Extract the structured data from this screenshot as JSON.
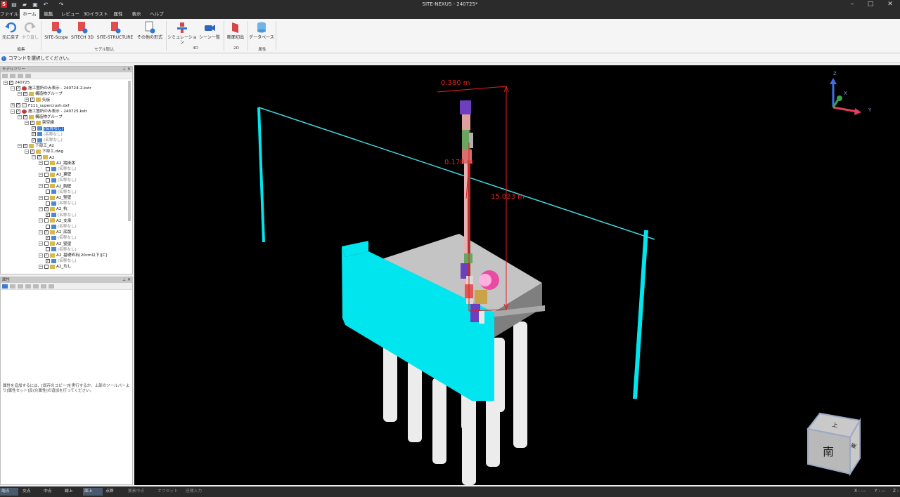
{
  "app": {
    "title": "SITE-NEXUS - 240725*",
    "logo": "S",
    "quick_access_icons": [
      "new-file-icon",
      "open-folder-icon",
      "save-icon",
      "undo-icon",
      "redo-icon"
    ]
  },
  "menu_tabs": [
    "ファイル",
    "ホーム",
    "編集",
    "レビュー",
    "3Dイラスト",
    "属性",
    "表示",
    "ヘルプ"
  ],
  "active_tab": "ホーム",
  "ribbon": {
    "buttons": {
      "undo": "元に戻す",
      "redo": "やり直し",
      "scope": "SITE-Scope",
      "sitech": "SITECH 3D",
      "structure": "SITE-STRUCTURE",
      "other": "その他の形式",
      "simulation": "シミュレーション",
      "scene_list": "シーン一覧",
      "section": "断面切出",
      "database": "データベース"
    },
    "groups": {
      "edit": "編集",
      "model": "モデル取込",
      "g4d": "4D",
      "g2d": "2D",
      "attr": "属性"
    }
  },
  "command_prompt": "コマンドを選択してください。",
  "model_tree": {
    "title": "モデルツリー",
    "rows": [
      {
        "label": "240725",
        "indent": 0,
        "icon": "none",
        "checked": true,
        "expanded": true
      },
      {
        "label": "施工箇所のみ表示 - 240724-2.kstr",
        "indent": 1,
        "icon": "red",
        "checked": true,
        "expanded": true
      },
      {
        "label": "構造物グループ",
        "indent": 2,
        "icon": "folder",
        "checked": true,
        "expanded": true
      },
      {
        "label": "矢板",
        "indent": 3,
        "icon": "folder",
        "checked": true,
        "expanded": false
      },
      {
        "label": "F111_supercrush.dxf",
        "indent": 1,
        "icon": "file",
        "checked": true,
        "expanded": false
      },
      {
        "label": "施工箇所のみ表示 - 240725.kstr",
        "indent": 1,
        "icon": "red",
        "checked": true,
        "expanded": true
      },
      {
        "label": "構造物グループ",
        "indent": 2,
        "icon": "folder",
        "checked": true,
        "expanded": true
      },
      {
        "label": "架空線",
        "indent": 3,
        "icon": "folder",
        "checked": true,
        "expanded": true
      },
      {
        "label": "(名称なし)",
        "indent": 4,
        "icon": "part",
        "checked": true,
        "selected": true
      },
      {
        "label": "(名称なし)",
        "indent": 4,
        "icon": "part",
        "checked": true,
        "dim": true
      },
      {
        "label": "(名称なし)",
        "indent": 4,
        "icon": "part",
        "checked": true,
        "dim": true
      },
      {
        "label": "下部工_A2",
        "indent": 2,
        "icon": "folder",
        "checked": true,
        "expanded": true
      },
      {
        "label": "下部工.dwg",
        "indent": 3,
        "icon": "folder",
        "checked": true,
        "expanded": true
      },
      {
        "label": "A2",
        "indent": 4,
        "icon": "folder",
        "checked": true,
        "expanded": true
      },
      {
        "label": "A2_踏掛版",
        "indent": 5,
        "icon": "folder",
        "checked": false,
        "expanded": true
      },
      {
        "label": "(名称なし)",
        "indent": 6,
        "icon": "part",
        "checked": false,
        "dim": true
      },
      {
        "label": "A2_翼壁",
        "indent": 5,
        "icon": "folder",
        "checked": false,
        "expanded": true
      },
      {
        "label": "(名称なし)",
        "indent": 6,
        "icon": "part",
        "checked": false,
        "dim": true
      },
      {
        "label": "A2_胸壁",
        "indent": 5,
        "icon": "folder",
        "checked": false,
        "expanded": true
      },
      {
        "label": "(名称なし)",
        "indent": 6,
        "icon": "part",
        "checked": false,
        "dim": true
      },
      {
        "label": "A2_竪壁",
        "indent": 5,
        "icon": "folder",
        "checked": false,
        "expanded": true
      },
      {
        "label": "(名称なし)",
        "indent": 6,
        "icon": "part",
        "checked": false,
        "dim": true
      },
      {
        "label": "A2_杭",
        "indent": 5,
        "icon": "folder",
        "checked": true,
        "expanded": true
      },
      {
        "label": "(名称なし)",
        "indent": 6,
        "icon": "part",
        "checked": true,
        "dim": true
      },
      {
        "label": "A2_支承",
        "indent": 5,
        "icon": "folder",
        "checked": false,
        "expanded": true
      },
      {
        "label": "(名称なし)",
        "indent": 6,
        "icon": "part",
        "checked": false,
        "dim": true
      },
      {
        "label": "A2_底版",
        "indent": 5,
        "icon": "folder",
        "checked": true,
        "expanded": true
      },
      {
        "label": "(名称なし)",
        "indent": 6,
        "icon": "part",
        "checked": true,
        "dim": true
      },
      {
        "label": "A2_堅壁",
        "indent": 5,
        "icon": "folder",
        "checked": false,
        "expanded": true
      },
      {
        "label": "(名称なし)",
        "indent": 6,
        "icon": "part",
        "checked": false,
        "dim": true
      },
      {
        "label": "A2_基礎砕石(20cm以下)[C]",
        "indent": 5,
        "icon": "folder",
        "checked": true,
        "expanded": true
      },
      {
        "label": "(名称なし)",
        "indent": 6,
        "icon": "part",
        "checked": true,
        "dim": true
      },
      {
        "label": "A2_均し",
        "indent": 5,
        "icon": "folder",
        "checked": false,
        "expanded": true
      }
    ]
  },
  "properties": {
    "title": "属性",
    "message": "属性を追加するには、[既存のコピー]を実行するか、上部のツールバーより[属性セット]及び[属性]の追加を行ってください。"
  },
  "viewport": {
    "dimensions": [
      "0.380 m",
      "0.178 m",
      "15.023 m"
    ],
    "axes": {
      "z": "Z",
      "x": "X",
      "y": "Y"
    },
    "view_cube_label": "南",
    "view_cube_top": "上",
    "view_cube_side": "東",
    "colors": {
      "abutment": "#00e5ee",
      "footing": "#b8b8b8",
      "piles": "#ececec",
      "wire": "#43d5e0",
      "dimension": "#e02020",
      "background": "#000000"
    }
  },
  "statusbar": {
    "snaps": [
      {
        "label": "端点",
        "state": "on"
      },
      {
        "label": "交点",
        "state": "normal"
      },
      {
        "label": "中点",
        "state": "normal"
      },
      {
        "label": "線上",
        "state": "normal"
      },
      {
        "label": "面上",
        "state": "on"
      },
      {
        "label": "点群",
        "state": "normal"
      },
      {
        "label": "要素中点",
        "state": "off"
      },
      {
        "label": "オフセット",
        "state": "off"
      },
      {
        "label": "座標入力",
        "state": "off"
      }
    ],
    "coords": {
      "x": "X : ---",
      "y": "Y : ---",
      "z": "Z :"
    }
  }
}
